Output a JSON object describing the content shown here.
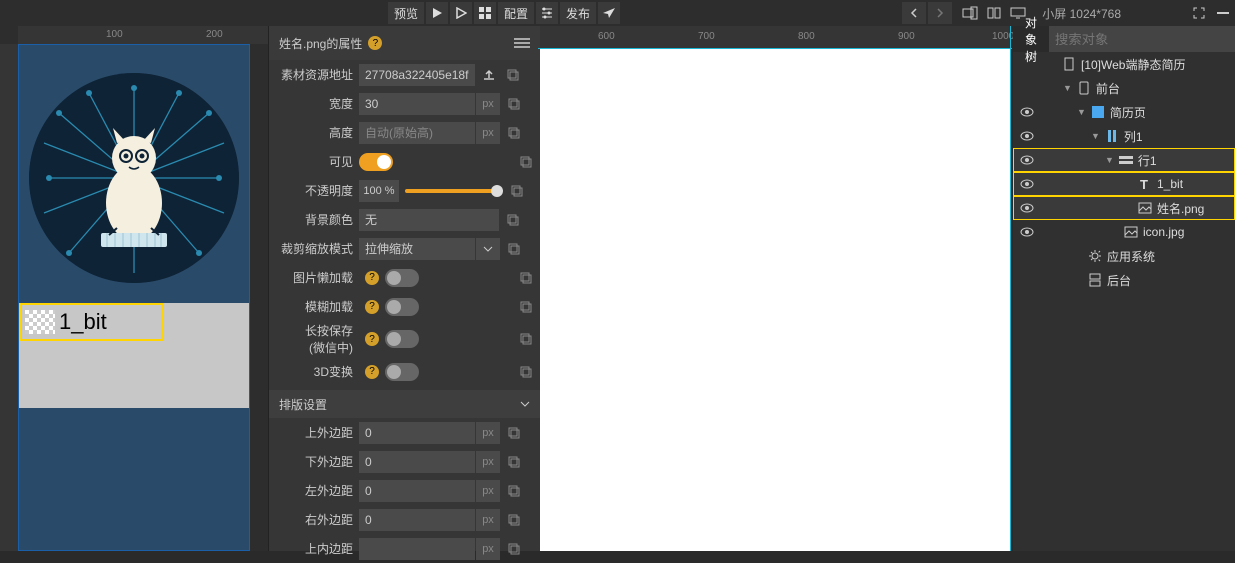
{
  "toolbar": {
    "preview": "预览",
    "config": "配置",
    "publish": "发布",
    "viewport": "小屏 1024*768"
  },
  "ruler": {
    "t100": "100",
    "t200": "200",
    "t600": "600",
    "t700": "700",
    "t800": "800",
    "t900": "900",
    "t1000": "1000"
  },
  "canvas": {
    "label_text": "1_bit"
  },
  "props": {
    "title": "姓名.png的属性",
    "rows": {
      "asset_url": "素材资源地址",
      "asset_url_val": "27708a322405e18f",
      "width": "宽度",
      "width_val": "30",
      "height": "高度",
      "height_ph": "自动(原始高)",
      "visible": "可见",
      "opacity": "不透明度",
      "opacity_val": "100 %",
      "bgcolor": "背景颜色",
      "bgcolor_val": "无",
      "scale_mode": "裁剪缩放模式",
      "scale_mode_val": "拉伸缩放",
      "lazy_load": "图片懒加载",
      "blur_load": "模糊加载",
      "long_press": "长按保存",
      "long_press2": "(微信中)",
      "transform3d": "3D变换"
    },
    "section_layout": "排版设置",
    "margins": {
      "top": "上外边距",
      "top_val": "0",
      "bottom": "下外边距",
      "bottom_val": "0",
      "left": "左外边距",
      "left_val": "0",
      "right": "右外边距",
      "right_val": "0",
      "ptop": "上内边距"
    },
    "unit_px": "px"
  },
  "tree": {
    "tab": "对象树",
    "search_ph": "搜索对象",
    "items": {
      "root": "[10]Web端静态简历",
      "front": "前台",
      "page": "简历页",
      "col1": "列1",
      "row1": "行1",
      "t1bit": "1_bit",
      "name_png": "姓名.png",
      "icon_jpg": "icon.jpg",
      "app_sys": "应用系统",
      "back": "后台"
    }
  }
}
